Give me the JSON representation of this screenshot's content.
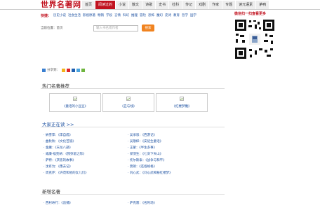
{
  "logo": "世界名著网",
  "nav": [
    {
      "label": "首页",
      "active": false
    },
    {
      "label": "阅读过的",
      "active": true
    },
    {
      "label": "小说",
      "active": false
    },
    {
      "label": "散文",
      "active": false
    },
    {
      "label": "诗歌",
      "active": false
    },
    {
      "label": "史书",
      "active": false
    },
    {
      "label": "杜科",
      "active": false
    },
    {
      "label": "传记",
      "active": false
    },
    {
      "label": "戏剧",
      "active": false
    },
    {
      "label": "作家",
      "active": false
    },
    {
      "label": "专题",
      "active": false
    },
    {
      "label": "读元语素",
      "active": false
    },
    {
      "label": "茅鸭",
      "active": false
    }
  ],
  "subnav": {
    "label": "快捷：",
    "items": [
      "历史小说",
      "社会生活",
      "影视原著",
      "畅销",
      "学段",
      "言情",
      "科幻",
      "推理",
      "冒险",
      "恐怖",
      "魔幻",
      "史诗",
      "教育",
      "哲学",
      "国学"
    ]
  },
  "wechat": {
    "text": "微信扫一扫查看更多"
  },
  "breadcrumb": "当前位置：首页",
  "search": {
    "placeholder": "输入书名或作者",
    "button": "搜索"
  },
  "share": {
    "label": "分享到：",
    "icons": [
      "qzone-icon",
      "weibo-icon",
      "renren-icon",
      "tencent-icon",
      "more-icon"
    ]
  },
  "sections": {
    "hot": "热门名著推荐",
    "reading": "大家正在读 >>",
    "new": "新增名著"
  },
  "hot_books": [
    "《童话的小豆豆》",
    "《丑与线》",
    "《红楼梦魔》"
  ],
  "reading_left": [
    "· 纳雪萍：《李自成》",
    "· 曲秋秋：《文化苦旅》",
    "· 金庸：《天龙八部》",
    "· 威廉·福克纳：《我弥留之际》",
    "· 萨特：《厌恶的故事》",
    "· 沈有为：《愚去记》",
    "· 周克芹：《许茂和他的女儿们》"
  ],
  "reading_right": [
    "· 吴承恩：《西游记》",
    "· 吴敬梓：《安徒生童话》",
    "· 王蒙：《半生多事》",
    "· 梁羽生：《七剑下天山》",
    "· 托尔斯泰：《战争与和平》",
    "· 莫顿：《还俗格格》",
    "· 刘心武：《刘心武揭秘红楼梦》"
  ],
  "new_books": [
    "· 西村寿行：《追捕》",
    "· 萨克雷：《名利场》"
  ]
}
